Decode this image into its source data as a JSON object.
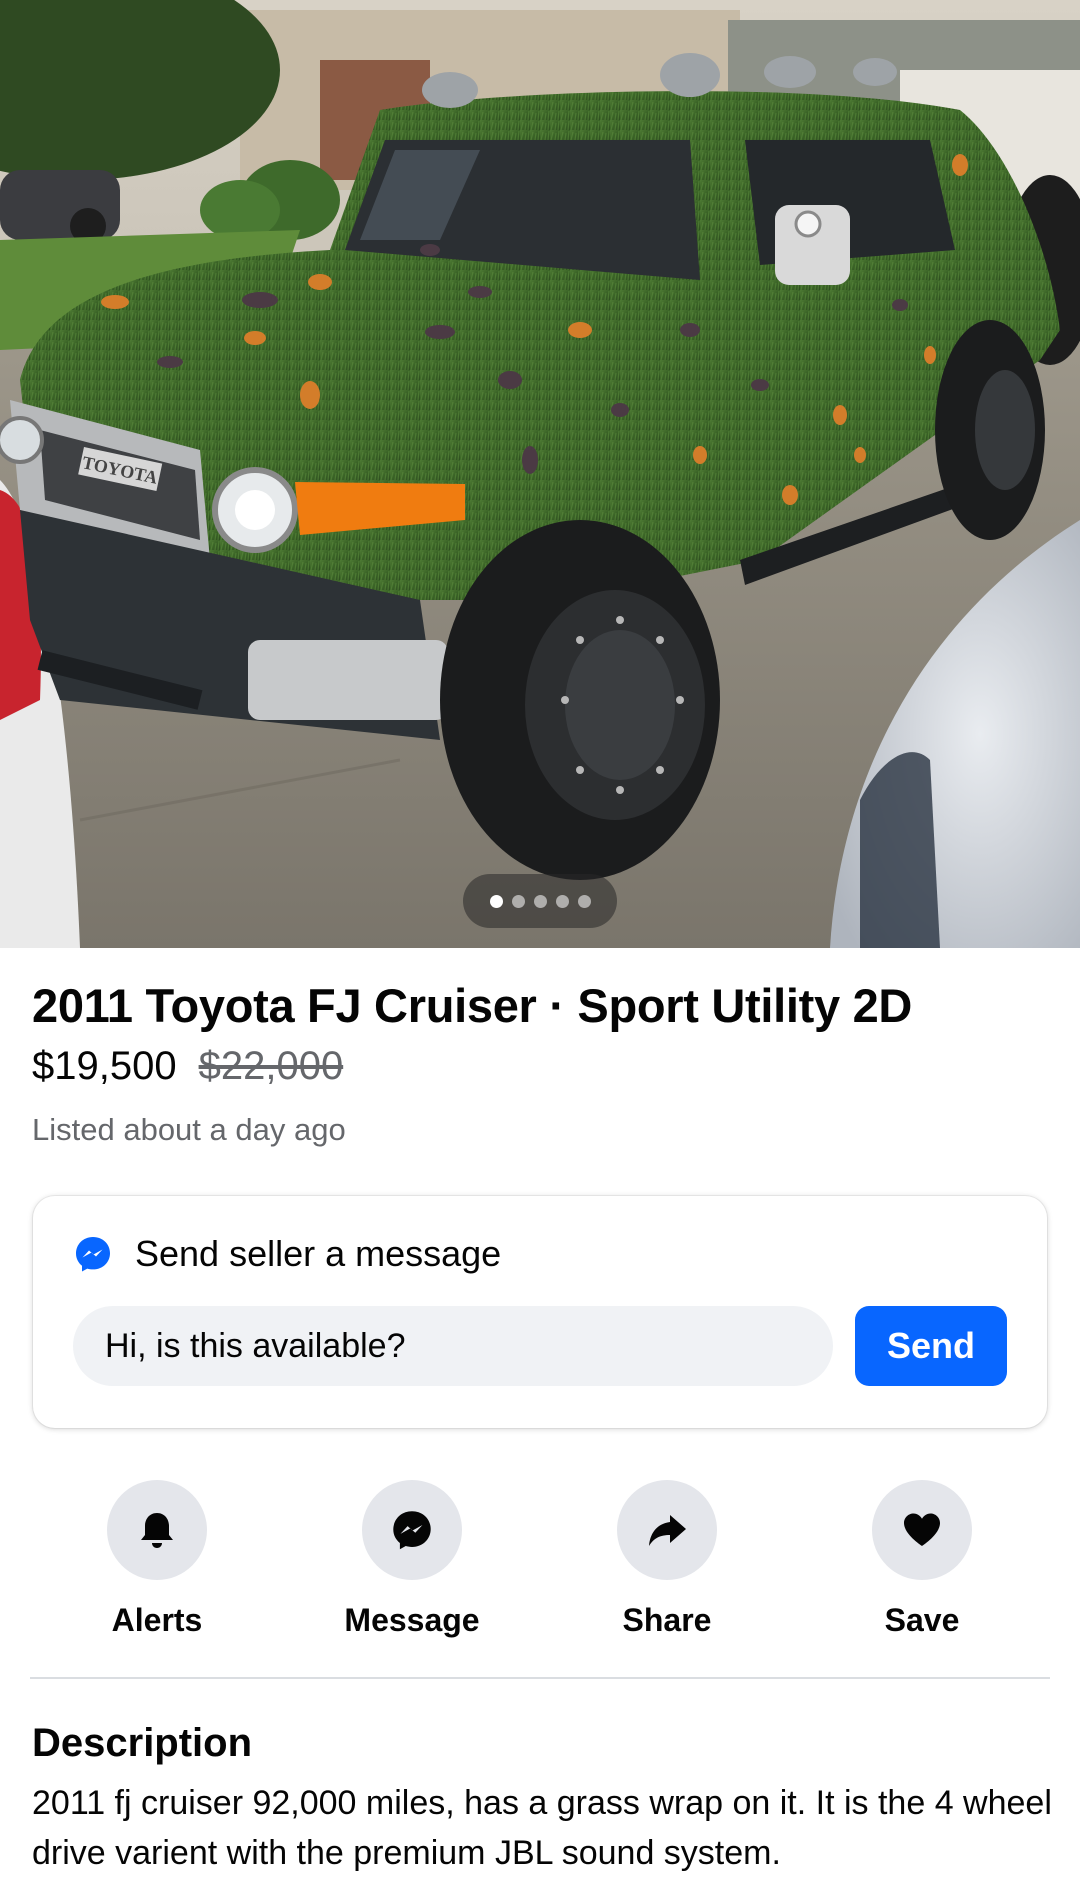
{
  "listing_photo": {
    "subject": "Toyota FJ Cruiser covered in artificial grass wrap with toy insects",
    "badge_text": "TOYOTA",
    "carousel": {
      "count": 5,
      "active_index": 0
    }
  },
  "listing": {
    "title": "2011 Toyota FJ Cruiser · Sport Utility 2D",
    "price": "$19,500",
    "original_price": "$22,000",
    "listed_time": "Listed about a day ago"
  },
  "message_box": {
    "heading": "Send seller a message",
    "input_value": "Hi, is this available?",
    "send_label": "Send"
  },
  "actions": [
    {
      "label": "Alerts",
      "icon": "bell-icon"
    },
    {
      "label": "Message",
      "icon": "messenger-icon"
    },
    {
      "label": "Share",
      "icon": "share-arrow-icon"
    },
    {
      "label": "Save",
      "icon": "heart-icon"
    }
  ],
  "description": {
    "heading": "Description",
    "body": "2011 fj cruiser 92,000 miles, has a grass wrap on it. It is the 4 wheel drive varient with the premium JBL sound system."
  },
  "colors": {
    "accent_blue": "#0866ff",
    "text_primary": "#050505",
    "text_secondary": "#65676b",
    "button_bg": "#e4e6eb",
    "grass_green": "#3f6b2a"
  }
}
